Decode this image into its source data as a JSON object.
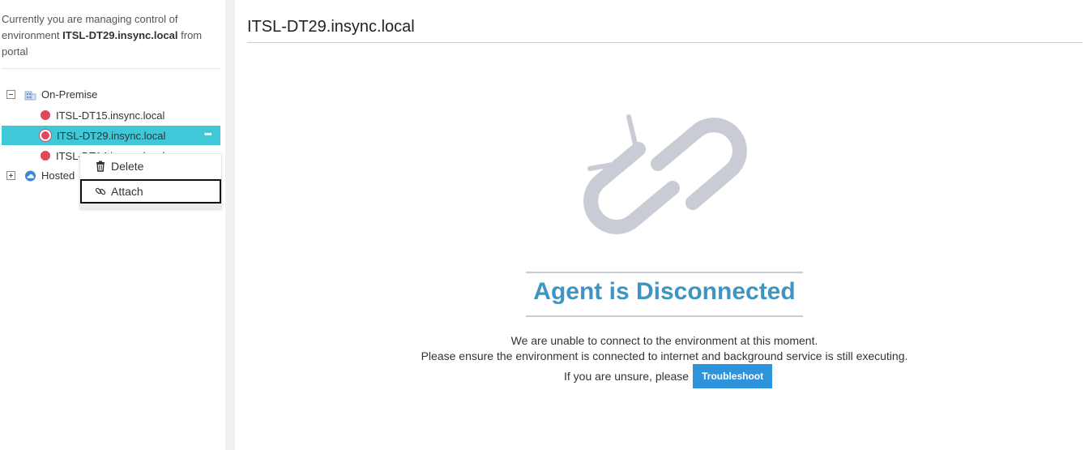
{
  "sidebar": {
    "manage_prefix": "Currently you are managing control of environment",
    "manage_env": "ITSL-DT29.insync.local",
    "manage_suffix": "from portal",
    "tree": {
      "on_premise_label": "On-Premise",
      "hosted_label": "Hosted",
      "items": [
        {
          "label": "ITSL-DT15.insync.local",
          "status": "disconnected"
        },
        {
          "label": "ITSL-DT29.insync.local",
          "status": "disconnected",
          "selected": true
        },
        {
          "label": "ITSL-DT14.insync.local",
          "status": "disconnected"
        }
      ]
    }
  },
  "context_menu": {
    "delete_label": "Delete",
    "attach_label": "Attach"
  },
  "main": {
    "title": "ITSL-DT29.insync.local",
    "status_title": "Agent is Disconnected",
    "message_line1": "We are unable to connect to the environment at this moment.",
    "message_line2": "Please ensure the environment is connected to internet and background service is still executing.",
    "unsure_text": "If you are unsure, please",
    "troubleshoot_label": "Troubleshoot"
  },
  "colors": {
    "selected_row": "#3ec8d8",
    "status_disconnected": "#e0475a",
    "status_title": "#3e95c1",
    "button": "#2d94dc",
    "broken_link_icon": "#c9ccd4"
  }
}
